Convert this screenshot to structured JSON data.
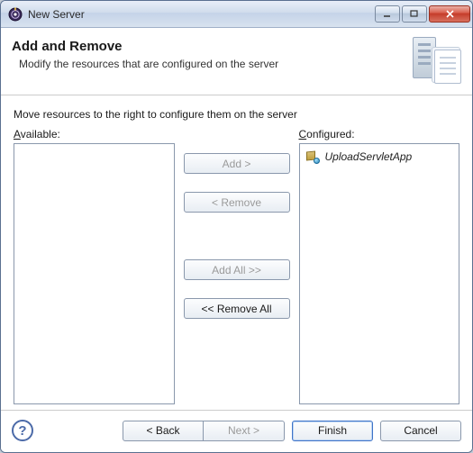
{
  "window": {
    "title": "New Server"
  },
  "banner": {
    "title": "Add and Remove",
    "description": "Modify the resources that are configured on the server"
  },
  "instruction": "Move resources to the right to configure them on the server",
  "labels": {
    "available": "vailable:",
    "available_prefix": "A",
    "configured": "onfigured:",
    "configured_prefix": "C"
  },
  "buttons": {
    "add": "Add >",
    "remove": "< Remove",
    "add_all": "Add All >>",
    "remove_all": "<< Remove All",
    "back": "< Back",
    "next": "Next >",
    "finish": "Finish",
    "cancel": "Cancel"
  },
  "available_items": [],
  "configured_items": [
    {
      "label": "UploadServletApp"
    }
  ]
}
